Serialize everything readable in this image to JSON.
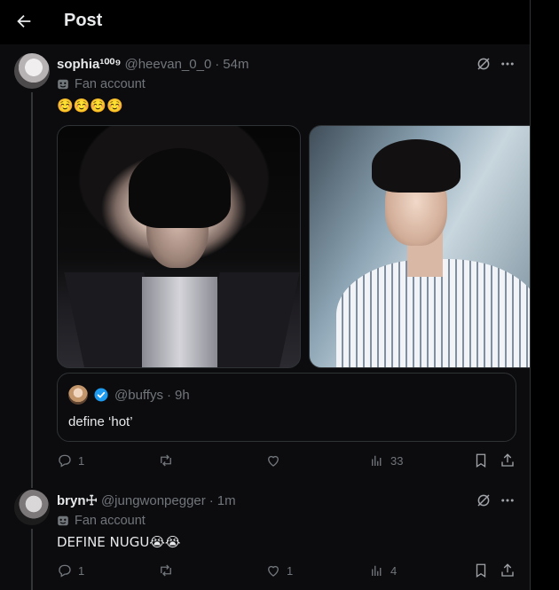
{
  "header": {
    "title": "Post"
  },
  "tweets": [
    {
      "name": "sophia¹⁰⁰⁹",
      "handle": "@heevan_0_0",
      "time": "54m",
      "label": "Fan account",
      "text": "☺️☺️☺️☺️",
      "quote": {
        "handle": "@buffys",
        "time": "9h",
        "text": "define ‘hot’"
      },
      "actions": {
        "replies": "1",
        "reposts": "",
        "likes": "",
        "views": "33"
      }
    },
    {
      "name": "bryn☩",
      "handle": "@jungwonpegger",
      "time": "1m",
      "label": "Fan account",
      "text": "DEFINE NUGU😭😭",
      "actions": {
        "replies": "1",
        "reposts": "",
        "likes": "1",
        "views": "4"
      }
    }
  ],
  "colors": {
    "background": "#000000",
    "tweet_bg": "#0c0c0e",
    "text": "#e7e9ea",
    "muted": "#71767b",
    "verified": "#1d9bf0"
  },
  "icons": [
    "back-arrow-icon",
    "grok-icon",
    "more-icon",
    "fan-mask-icon",
    "verified-badge-icon",
    "reply-icon",
    "repost-icon",
    "like-icon",
    "views-icon",
    "bookmark-icon",
    "share-icon"
  ]
}
